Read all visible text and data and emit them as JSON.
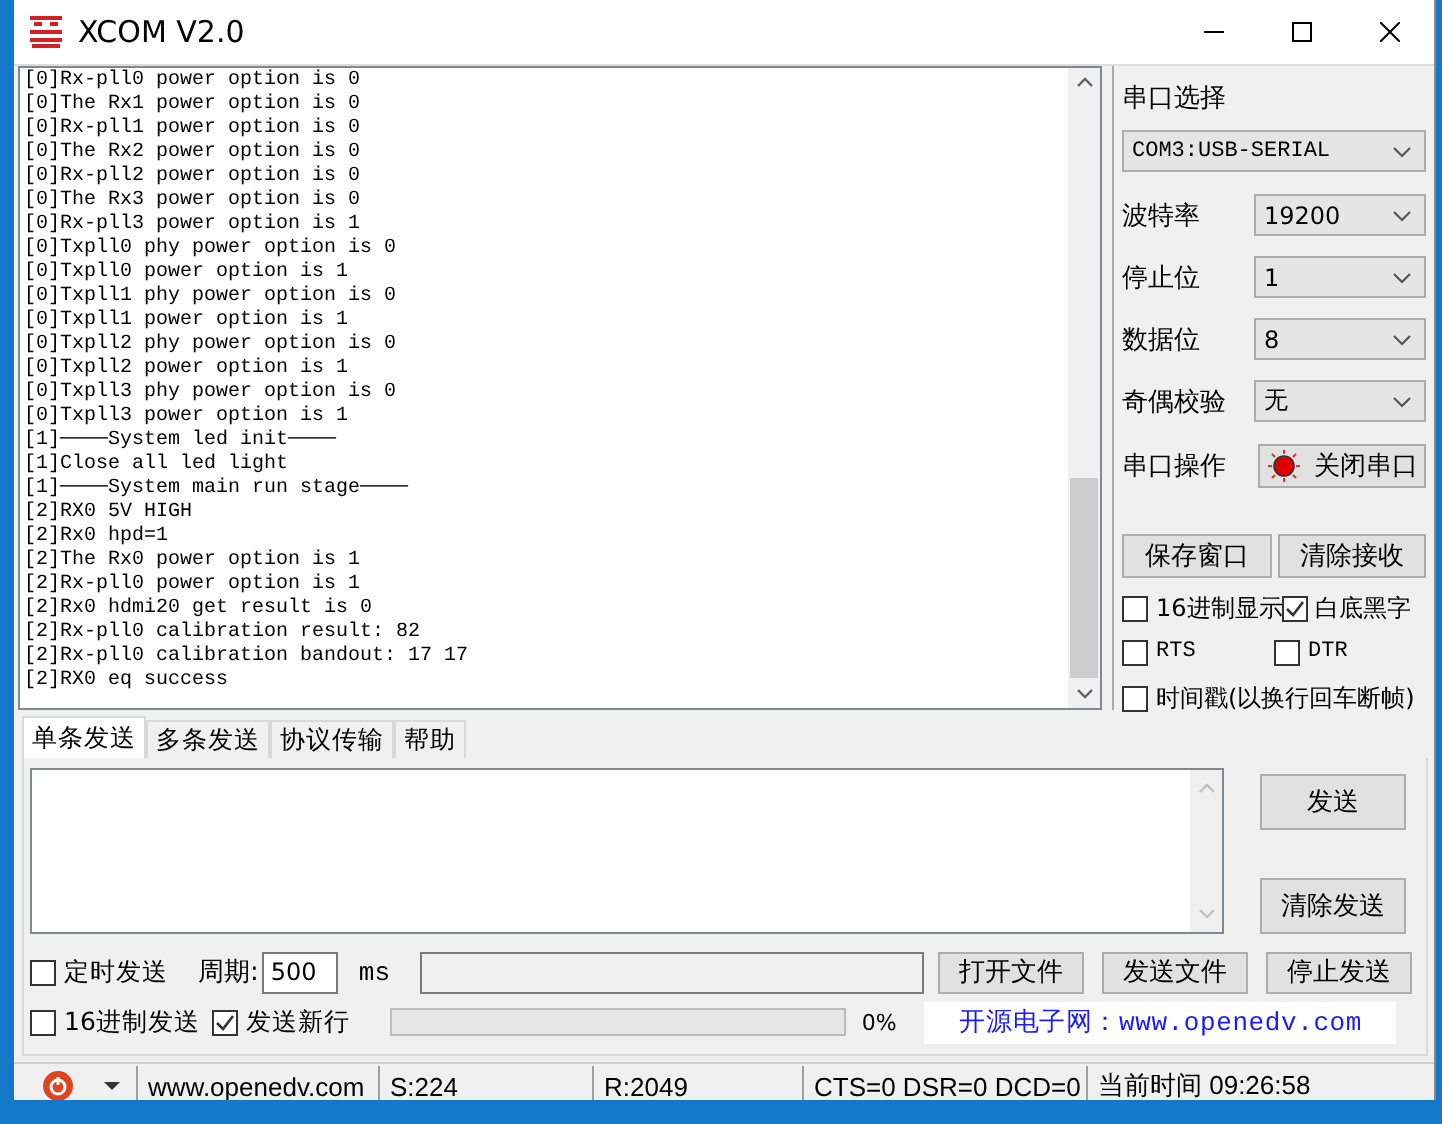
{
  "window": {
    "title": "XCOM V2.0"
  },
  "log": {
    "lines": [
      "[0]Rx-pll0 power option is 0",
      "[0]The Rx1 power option is 0",
      "[0]Rx-pll1 power option is 0",
      "[0]The Rx2 power option is 0",
      "[0]Rx-pll2 power option is 0",
      "[0]The Rx3 power option is 0",
      "[0]Rx-pll3 power option is 1",
      "[0]Txpll0 phy power option is 0",
      "[0]Txpll0 power option is 1",
      "[0]Txpll1 phy power option is 0",
      "[0]Txpll1 power option is 1",
      "[0]Txpll2 phy power option is 0",
      "[0]Txpll2 power option is 1",
      "[0]Txpll3 phy power option is 0",
      "[0]Txpll3 power option is 1",
      "[1]────System led init────",
      "[1]Close all led light",
      "[1]────System main run stage────",
      "[2]RX0 5V HIGH",
      "[2]Rx0 hpd=1",
      "[2]The Rx0 power option is 1",
      "[2]Rx-pll0 power option is 1",
      "[2]Rx0 hdmi20 get result is 0",
      "[2]Rx-pll0 calibration result: 82",
      "[2]Rx-pll0 calibration bandout: 17 17",
      "[2]RX0 eq success"
    ]
  },
  "serial_panel": {
    "title": "串口选择",
    "port": "COM3:USB-SERIAL",
    "settings": [
      {
        "label": "波特率",
        "value": "19200"
      },
      {
        "label": "停止位",
        "value": "1"
      },
      {
        "label": "数据位",
        "value": "8"
      },
      {
        "label": "奇偶校验",
        "value": "无"
      }
    ],
    "operation": {
      "label": "串口操作",
      "button": "关闭串口",
      "open": true
    },
    "buttons": [
      "保存窗口",
      "清除接收"
    ],
    "options": [
      {
        "label": "16进制显示",
        "checked": false
      },
      {
        "label": "白底黑字",
        "checked": true
      },
      {
        "label": "RTS",
        "checked": false
      },
      {
        "label": "DTR",
        "checked": false
      },
      {
        "label": "时间戳(以换行回车断帧)",
        "checked": false
      }
    ]
  },
  "send_tabs": [
    {
      "label": "单条发送",
      "selected": true
    },
    {
      "label": "多条发送",
      "selected": false
    },
    {
      "label": "协议传输",
      "selected": false
    },
    {
      "label": "帮助",
      "selected": false
    }
  ],
  "send": {
    "buttons": [
      "发送",
      "清除发送"
    ],
    "timed": {
      "label": "定时发送",
      "checked": false
    },
    "period_label": "周期:",
    "period": "500",
    "unit": "ms",
    "hex": {
      "label": "16进制发送",
      "checked": false
    },
    "newline": {
      "label": "发送新行",
      "checked": true
    },
    "file_buttons": [
      "打开文件",
      "发送文件",
      "停止发送"
    ],
    "progress": {
      "level": 0
    },
    "progress_reading": "0%",
    "banner": "开源电子网：www.openedv.com"
  },
  "status_bar": {
    "url": "www.openedv.com",
    "sent": "S:224",
    "received": "R:2049",
    "lines": "CTS=0 DSR=0 DCD=0",
    "time": "当前时间 09:26:58"
  }
}
